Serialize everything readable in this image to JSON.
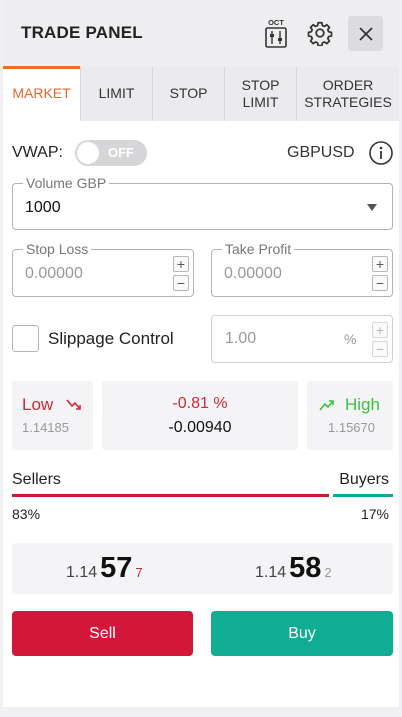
{
  "header": {
    "title": "TRADE PANEL",
    "calendar_icon_text": "OCT",
    "icons": [
      "calendar-settings-icon",
      "gear-icon",
      "close-icon"
    ]
  },
  "tabs": [
    {
      "label": "MARKET",
      "active": true
    },
    {
      "label": "LIMIT",
      "active": false
    },
    {
      "label": "STOP",
      "active": false
    },
    {
      "label": "STOP LIMIT",
      "active": false
    },
    {
      "label": "ORDER STRATEGIES",
      "active": false
    }
  ],
  "vwap": {
    "label": "VWAP:",
    "toggle_text": "OFF",
    "symbol": "GBPUSD",
    "info_icon": "info-icon"
  },
  "volume": {
    "legend": "Volume GBP",
    "value": "1000"
  },
  "stop_loss": {
    "legend": "Stop Loss",
    "placeholder": "0.00000"
  },
  "take_profit": {
    "legend": "Take Profit",
    "placeholder": "0.00000"
  },
  "stepper": {
    "plus": "+",
    "minus": "−"
  },
  "slippage": {
    "label": "Slippage Control",
    "value": "1.00",
    "unit": "%"
  },
  "stats": {
    "low_label": "Low",
    "low_value": "1.14185",
    "change_pct": "-0.81 %",
    "change_abs": "-0.00940",
    "high_label": "High",
    "high_value": "1.15670"
  },
  "sentiment": {
    "sellers_label": "Sellers",
    "buyers_label": "Buyers",
    "sellers_pct": "83%",
    "buyers_pct": "17%",
    "sellers_fraction": 0.83
  },
  "prices": {
    "bid": {
      "base": "1.14",
      "big": "57",
      "pip": "7"
    },
    "ask": {
      "base": "1.14",
      "big": "58",
      "pip": "2"
    }
  },
  "buttons": {
    "sell": "Sell",
    "buy": "Buy"
  },
  "colors": {
    "accent": "#ec6a2c",
    "sell": "#d2173a",
    "buy": "#0fae93",
    "down": "#cc2b35",
    "up": "#39c23f"
  }
}
